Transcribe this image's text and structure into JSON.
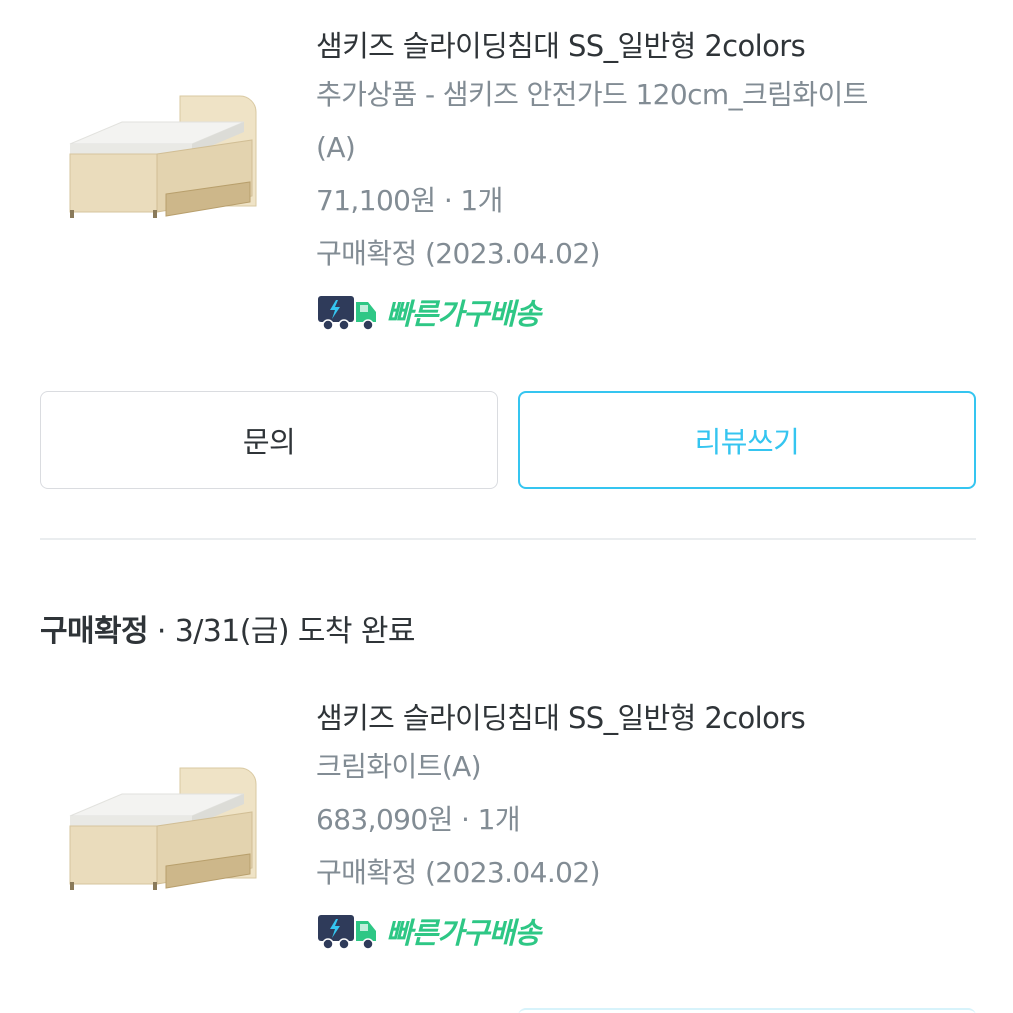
{
  "orders": [
    {
      "title": "샘키즈 슬라이딩침대 SS_일반형 2colors",
      "option_lines": [
        "추가상품 - 샘키즈 안전가드 120cm_크림화이트",
        "(A)"
      ],
      "price_qty": "71,100원 · 1개",
      "status": "구매확정 (2023.04.02)",
      "badge": {
        "icon": "delivery-truck-icon",
        "label": "빠른가구배송",
        "color": "#2ec785"
      }
    },
    {
      "title": "샘키즈 슬라이딩침대 SS_일반형 2colors",
      "option_lines": [
        "크림화이트(A)"
      ],
      "price_qty": "683,090원 · 1개",
      "status": "구매확정 (2023.04.02)",
      "badge": {
        "icon": "delivery-truck-icon",
        "label": "빠른가구배송",
        "color": "#2ec785"
      }
    }
  ],
  "actions": {
    "inquiry_label": "문의",
    "review_label": "리뷰쓰기",
    "review_color": "#35c5f0"
  },
  "group_status": {
    "status": "구매확정",
    "detail": " · 3/31(금) 도착 완료"
  }
}
